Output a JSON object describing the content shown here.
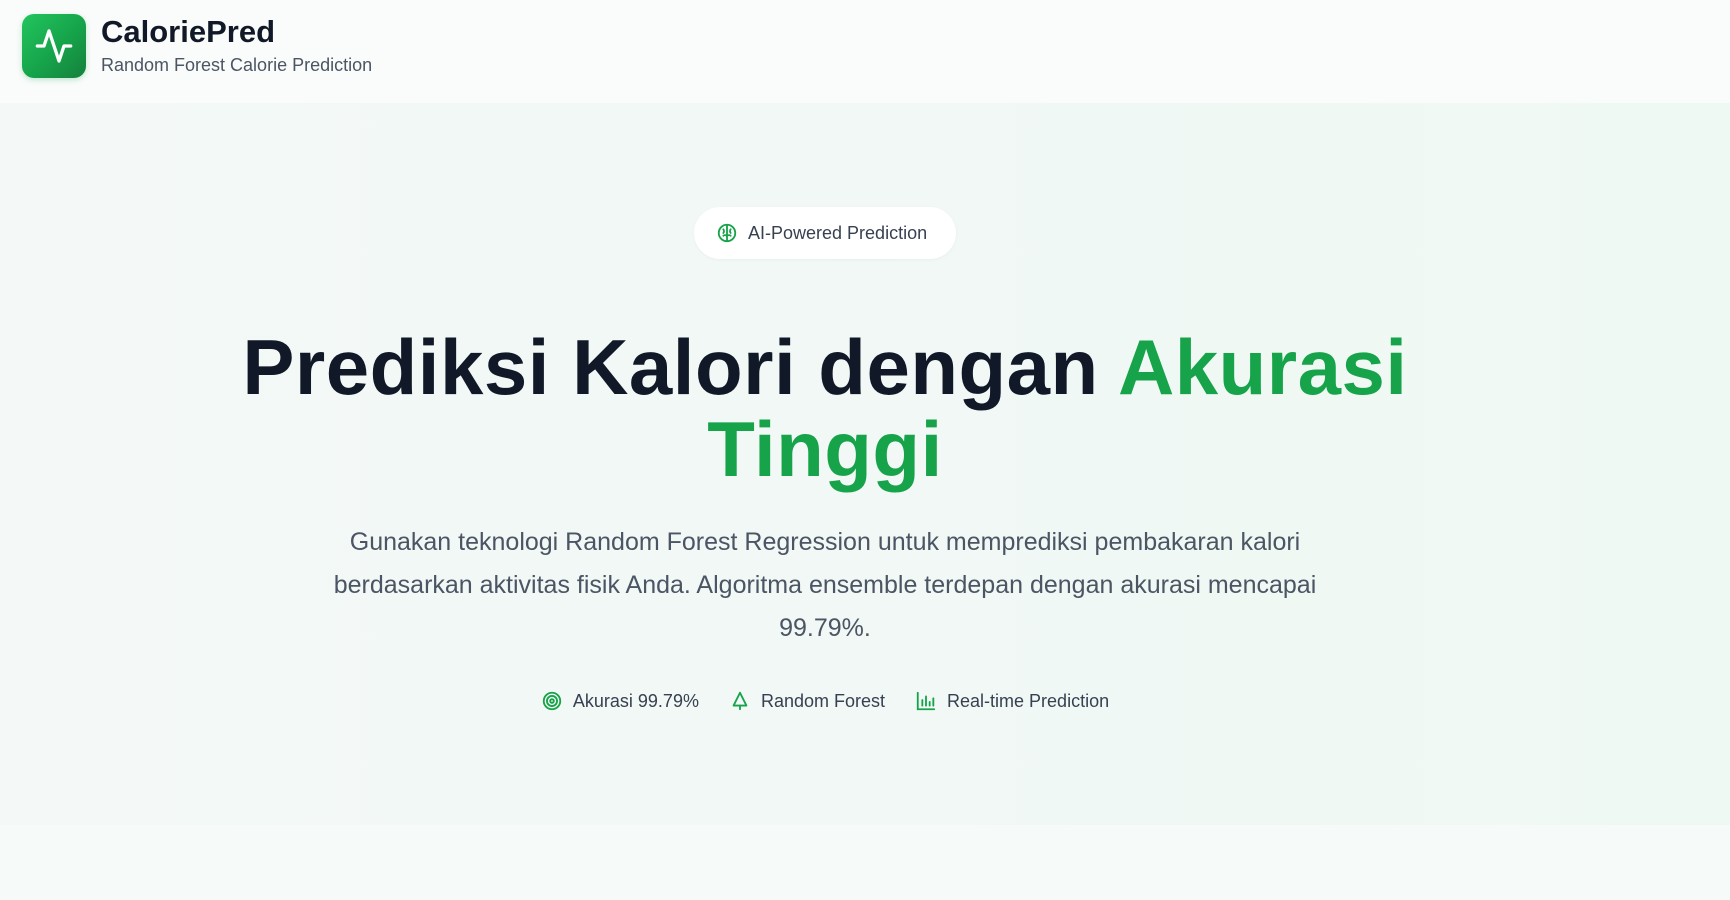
{
  "header": {
    "logo_icon": "activity-pulse-icon",
    "title": "CaloriePred",
    "subtitle": "Random Forest Calorie Prediction"
  },
  "hero": {
    "badge": {
      "icon": "brain-icon",
      "label": "AI-Powered Prediction"
    },
    "headline_main": "Prediksi Kalori dengan ",
    "headline_accent_1": "Akurasi",
    "headline_accent_2": "Tinggi",
    "description": "Gunakan teknologi Random Forest Regression untuk memprediksi pembakaran kalori berdasarkan aktivitas fisik Anda. Algoritma ensemble terdepan dengan akurasi mencapai 99.79%.",
    "features": [
      {
        "icon": "target-icon",
        "label": "Akurasi 99.79%"
      },
      {
        "icon": "tree-icon",
        "label": "Random Forest"
      },
      {
        "icon": "bar-chart-icon",
        "label": "Real-time Prediction"
      }
    ]
  },
  "colors": {
    "accent": "#16a34a",
    "heading": "#111827",
    "body_text": "#4b5563"
  }
}
